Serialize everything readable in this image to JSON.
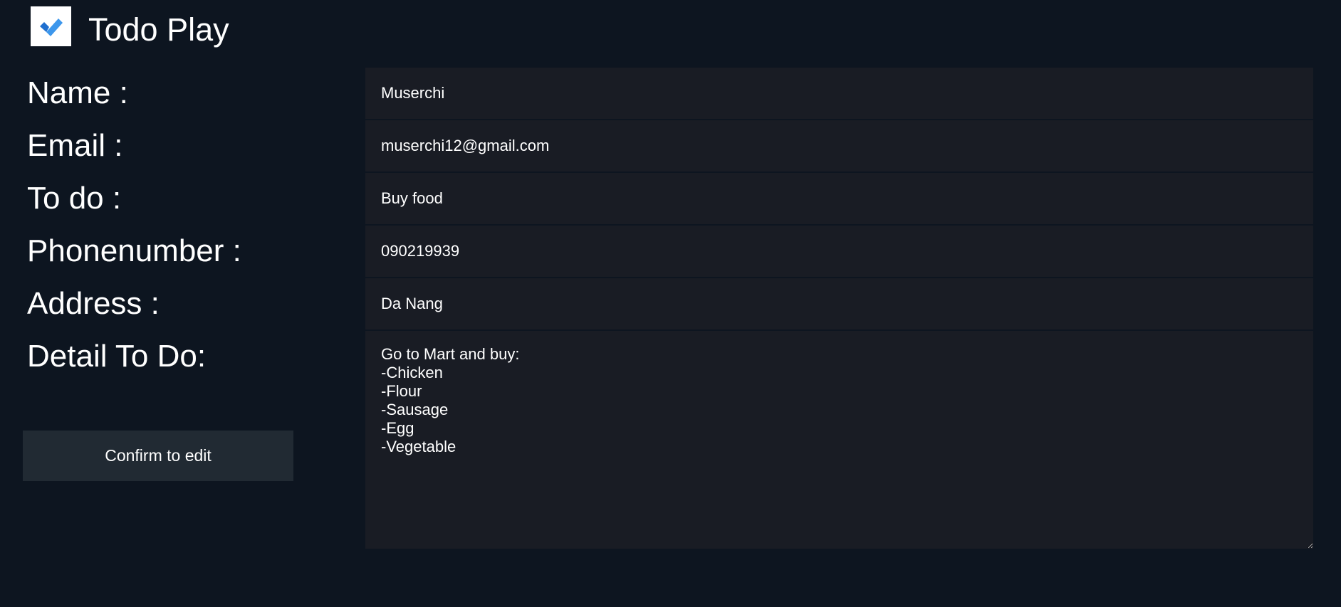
{
  "app": {
    "title": "Todo Play",
    "logo_icon": "checkmark-icon",
    "colors": {
      "background": "#0d1520",
      "field_background": "#191c24",
      "button_background": "#212a33",
      "logo_check_dark": "#1f6fcf",
      "logo_check_light": "#3d97ec"
    }
  },
  "form": {
    "labels": {
      "name": "Name :",
      "email": "Email :",
      "todo": "To do :",
      "phone": "Phonenumber :",
      "address": "Address :",
      "detail": "Detail To Do:"
    },
    "values": {
      "name": "Muserchi",
      "email": "muserchi12@gmail.com",
      "todo": "Buy food",
      "phone": "090219939",
      "address": "Da Nang",
      "detail": "Go to Mart and buy:\n-Chicken\n-Flour\n-Sausage\n-Egg\n-Vegetable"
    },
    "confirm_label": "Confirm to edit"
  }
}
